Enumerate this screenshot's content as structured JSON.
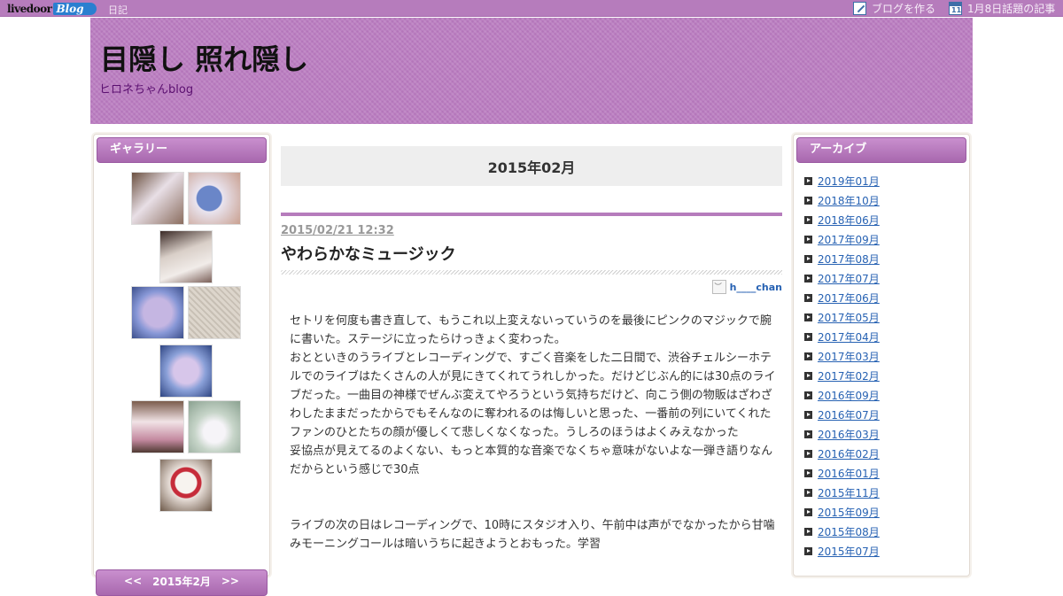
{
  "topbar": {
    "logo_main": "livedoor",
    "logo_blog": "Blog",
    "diary_link": "日記",
    "write_blog": "ブログを作る",
    "topic_articles": "1月8日話題の記事",
    "calendar_icon_day": "11"
  },
  "header": {
    "title": "目隠し 照れ隠し",
    "subtitle": "ヒロネちゃんblog"
  },
  "gallery": {
    "heading": "ギャラリー",
    "thumbnail_count": 9
  },
  "calendar": {
    "prev": "<<",
    "label": "2015年2月",
    "next": ">>"
  },
  "main": {
    "month_heading": "2015年02月",
    "entry": {
      "datetime": "2015/02/21 12:32",
      "title": "やわらかなミュージック",
      "author": "h____chan",
      "paragraphs": [
        "セトリを何度も書き直して、もうこれ以上変えないっていうのを最後にピンクのマジックで腕に書いた。ステージに立ったらけっきょく変わった。",
        "おとといきのうライブとレコーディングで、すごく音楽をした二日間で、渋谷チェルシーホテルでのライブはたくさんの人が見にきてくれてうれしかった。だけどじぶん的には30点のライブだった。一曲目の神様でぜんぶ変えてやろうという気持ちだけど、向こう側の物販はざわざわしたままだったからでもそんなのに奪われるのは悔しいと思った、一番前の列にいてくれたファンのひとたちの顔が優しくて悲しくなくなった。うしろのほうはよくみえなかった",
        "妥協点が見えてるのよくない、もっと本質的な音楽でなくちゃ意味がないよな一弾き語りなんだからという感じで30点",
        "ライブの次の日はレコーディングで、10時にスタジオ入り、午前中は声がでなかったから甘噛みモーニングコールは暗いうちに起きようとおもった。学習"
      ]
    }
  },
  "archive": {
    "heading": "アーカイブ",
    "items": [
      "2019年01月",
      "2018年10月",
      "2018年06月",
      "2017年09月",
      "2017年08月",
      "2017年07月",
      "2017年06月",
      "2017年05月",
      "2017年04月",
      "2017年03月",
      "2017年02月",
      "2016年09月",
      "2016年07月",
      "2016年03月",
      "2016年02月",
      "2016年01月",
      "2015年11月",
      "2015年09月",
      "2015年08月",
      "2015年07月"
    ]
  },
  "colors": {
    "accent": "#b67cbc",
    "link": "#2762b3"
  }
}
